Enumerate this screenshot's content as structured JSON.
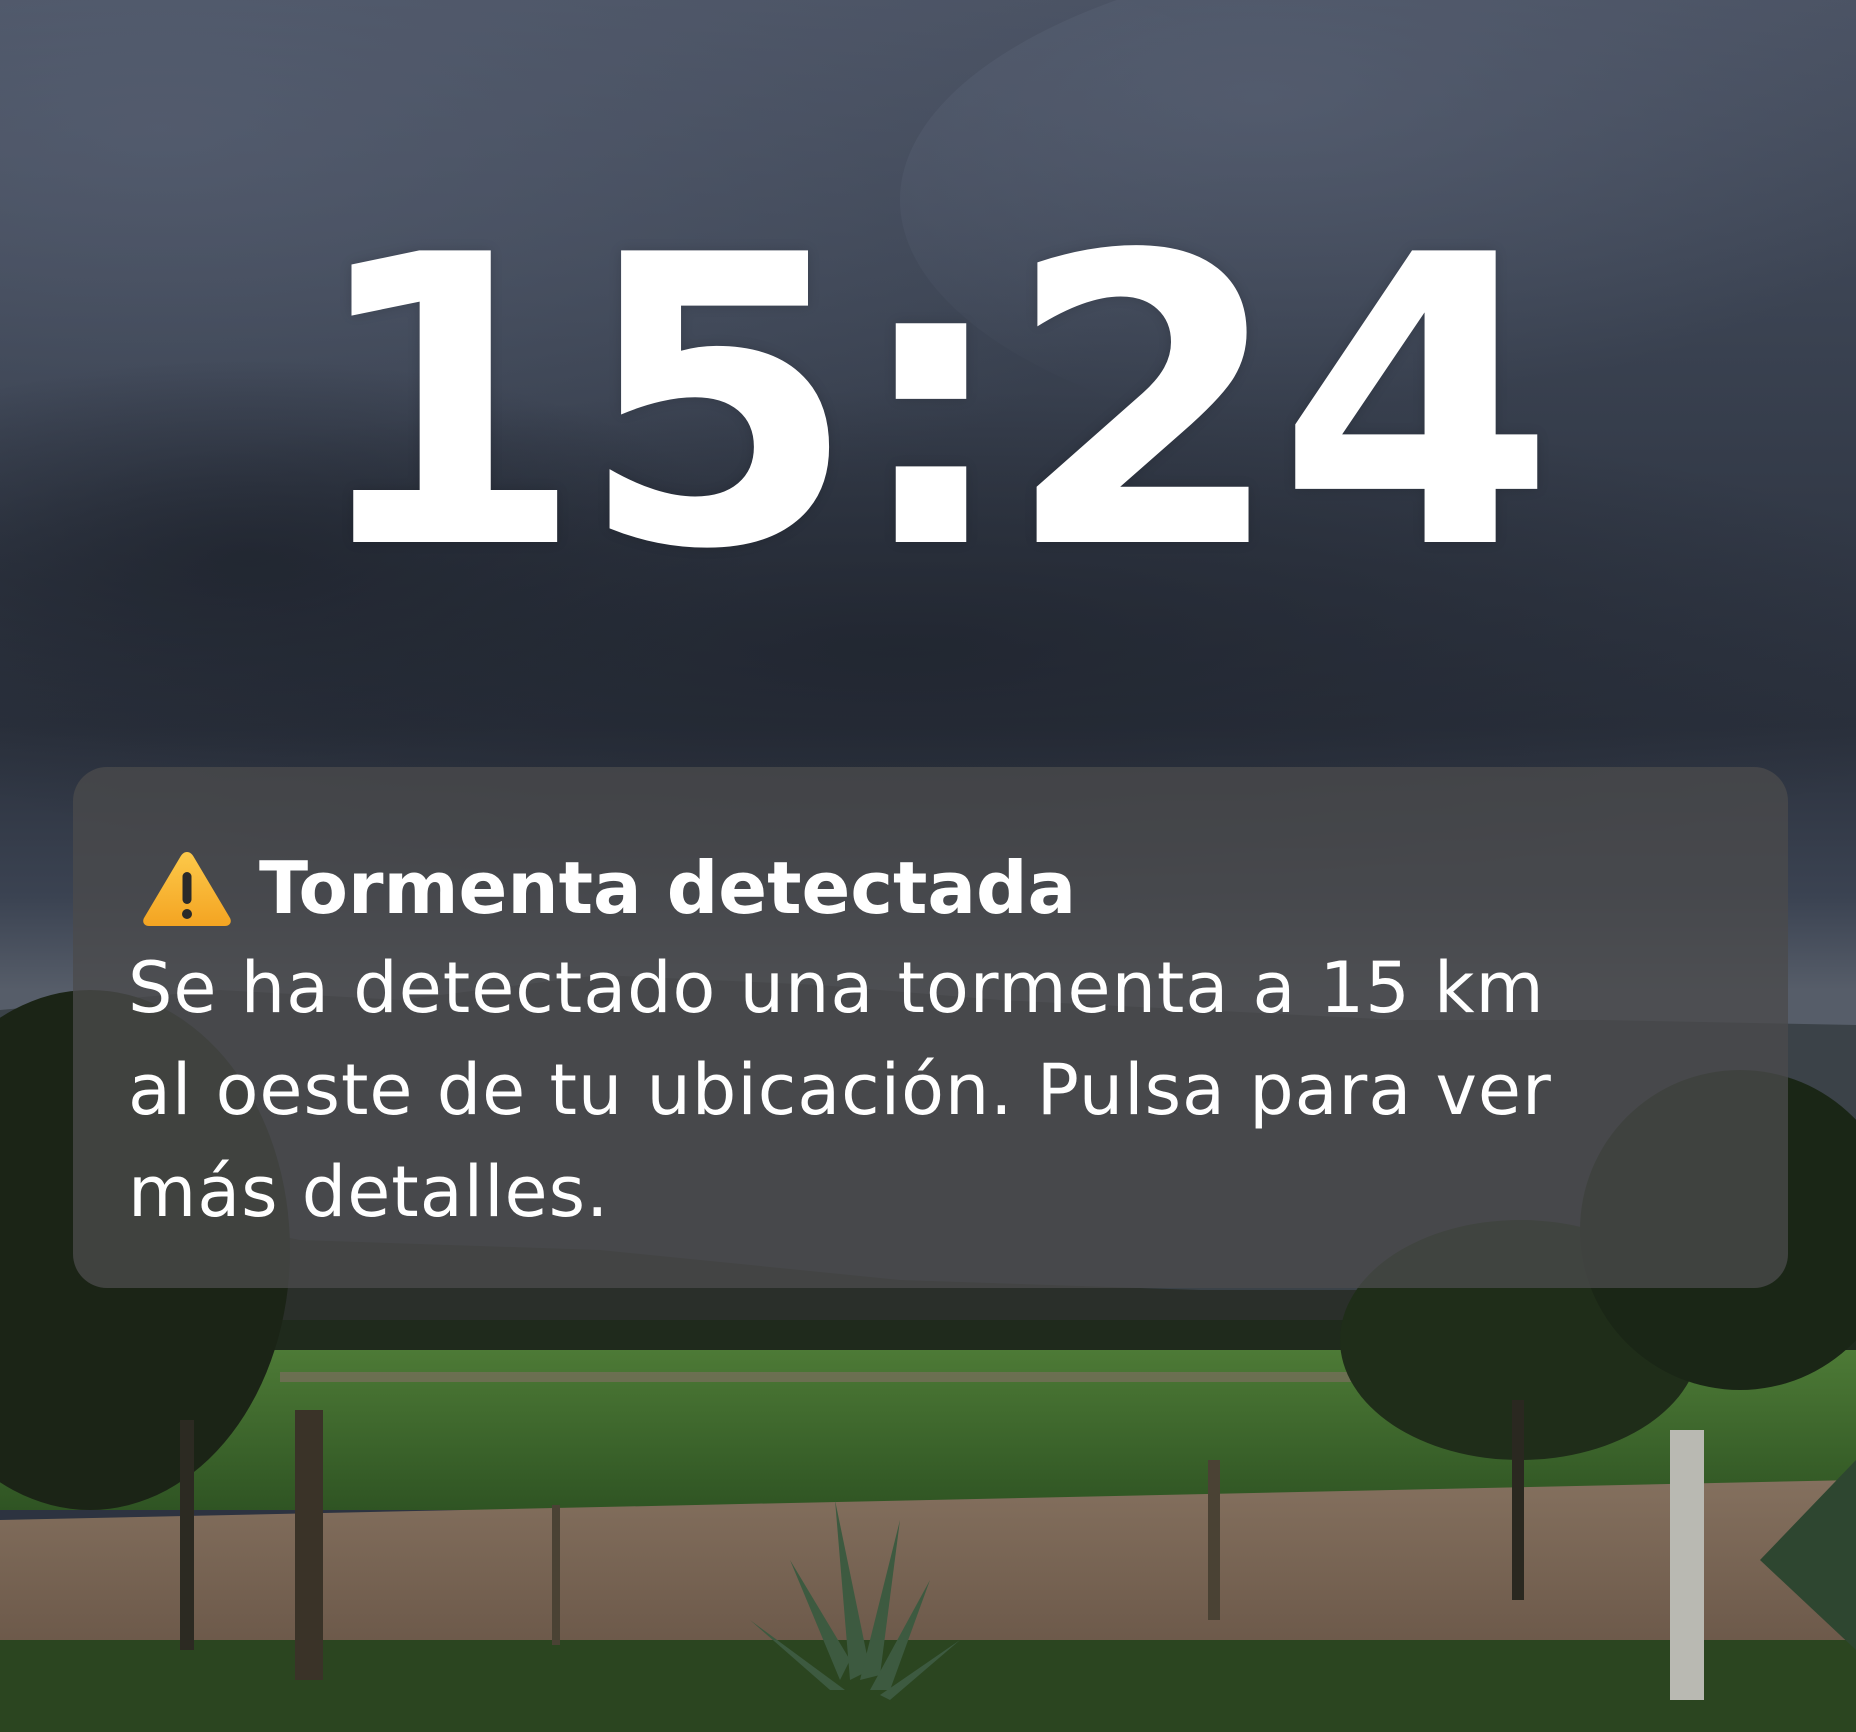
{
  "lockscreen": {
    "time": "15:24"
  },
  "notification": {
    "icon": "warning-icon",
    "title": "Tormenta detectada",
    "body_lines": [
      "Se ha detectado una tormenta a 15 km",
      "al oeste de tu ubicación. Pulsa para ver",
      "más detalles."
    ]
  },
  "colors": {
    "sky": "#3a4150",
    "field_green": "#3f6a2c",
    "dirt": "#7a6553",
    "warning_yellow": "#f7b733",
    "notification_bg": "#4a4a4c"
  }
}
